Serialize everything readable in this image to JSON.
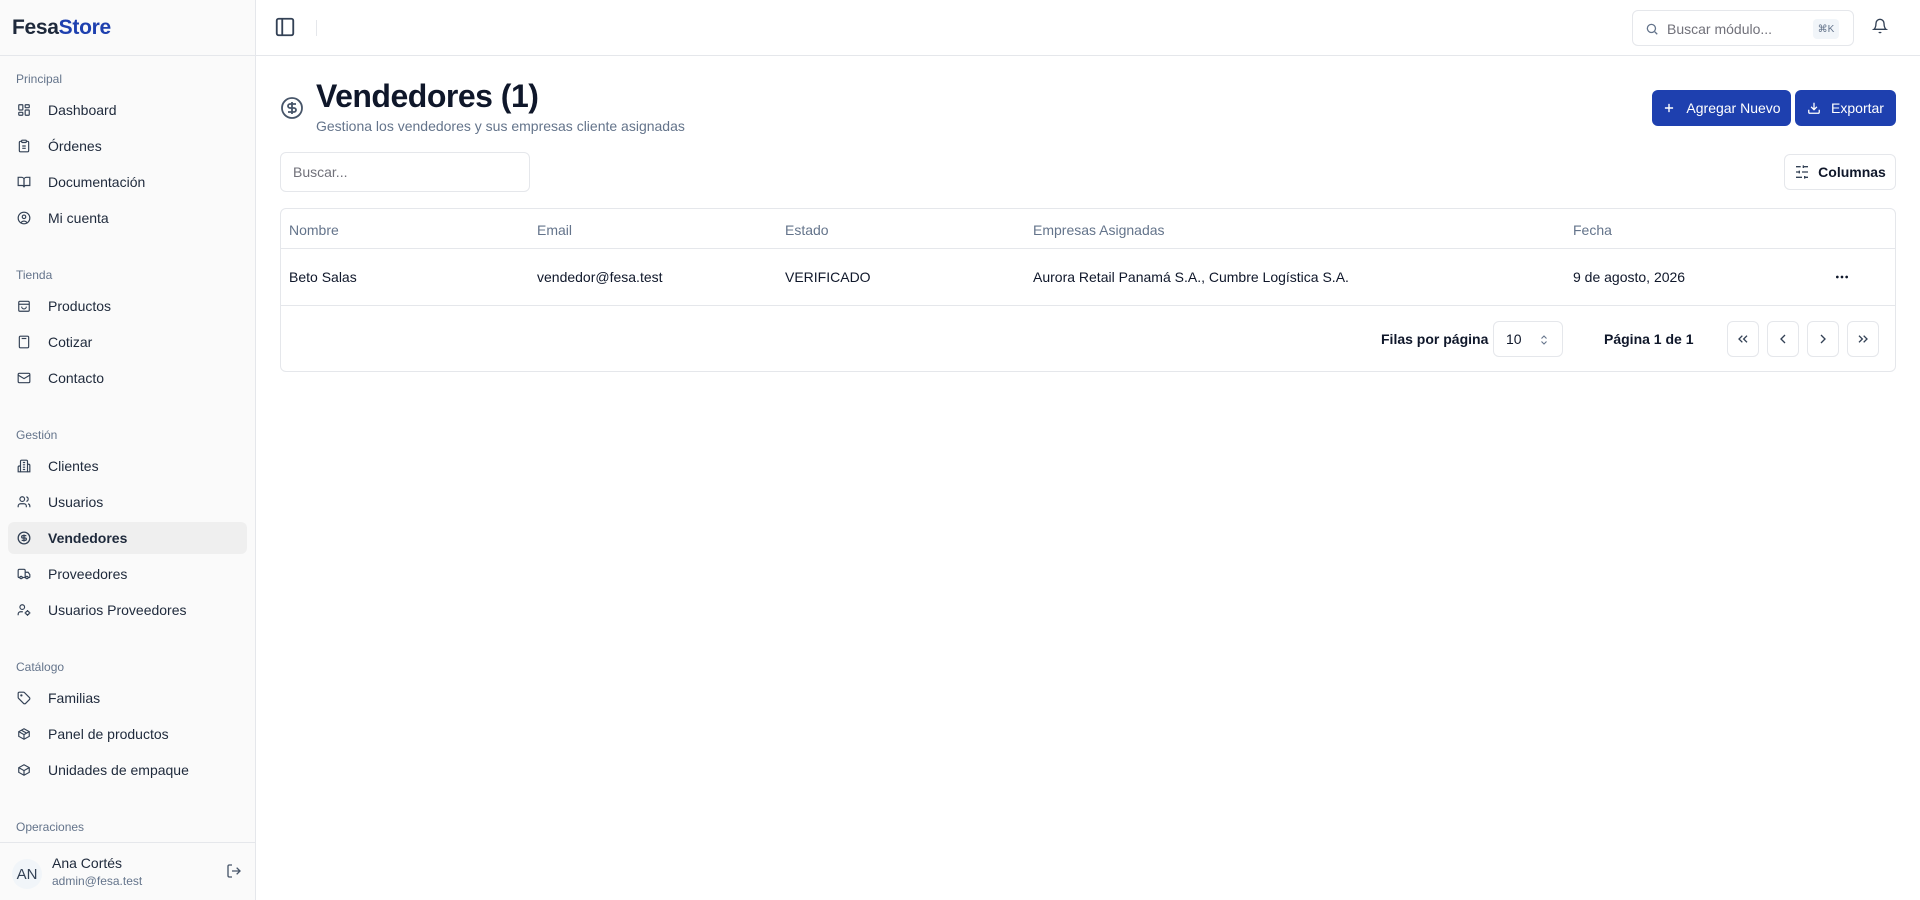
{
  "brand": {
    "part1": "Fesa",
    "part2": "Store"
  },
  "sidebar": {
    "groups": [
      {
        "label": "Principal",
        "items": [
          {
            "label": "Dashboard",
            "icon": "dashboard-icon"
          },
          {
            "label": "Órdenes",
            "icon": "clipboard-icon"
          },
          {
            "label": "Documentación",
            "icon": "book-open-icon"
          },
          {
            "label": "Mi cuenta",
            "icon": "user-circle-icon"
          }
        ]
      },
      {
        "label": "Tienda",
        "items": [
          {
            "label": "Productos",
            "icon": "shopping-bag-icon"
          },
          {
            "label": "Cotizar",
            "icon": "calculator-icon"
          },
          {
            "label": "Contacto",
            "icon": "mail-icon"
          }
        ]
      },
      {
        "label": "Gestión",
        "items": [
          {
            "label": "Clientes",
            "icon": "building-icon"
          },
          {
            "label": "Usuarios",
            "icon": "users-icon"
          },
          {
            "label": "Vendedores",
            "icon": "dollar-circle-icon",
            "active": true
          },
          {
            "label": "Proveedores",
            "icon": "truck-icon"
          },
          {
            "label": "Usuarios Proveedores",
            "icon": "user-cog-icon"
          }
        ]
      },
      {
        "label": "Catálogo",
        "items": [
          {
            "label": "Familias",
            "icon": "tag-icon"
          },
          {
            "label": "Panel de productos",
            "icon": "package-icon"
          },
          {
            "label": "Unidades de empaque",
            "icon": "box-icon"
          }
        ]
      },
      {
        "label": "Operaciones",
        "items": []
      }
    ],
    "user": {
      "initials": "AN",
      "name": "Ana Cortés",
      "email": "admin@fesa.test"
    }
  },
  "topbar": {
    "search_placeholder": "Buscar módulo...",
    "shortcut": "⌘K"
  },
  "main": {
    "title": "Vendedores (1)",
    "subtitle": "Gestiona los vendedores y sus empresas cliente asignadas",
    "add_label": "Agregar Nuevo",
    "export_label": "Exportar",
    "filter_placeholder": "Buscar...",
    "columns_label": "Columnas"
  },
  "table": {
    "headers": [
      "Nombre",
      "Email",
      "Estado",
      "Empresas Asignadas",
      "Fecha"
    ],
    "rows": [
      {
        "nombre": "Beto Salas",
        "email": "vendedor@fesa.test",
        "estado": "VERIFICADO",
        "empresas": "Aurora Retail Panamá S.A., Cumbre Logística S.A.",
        "fecha": "9 de agosto, 2026"
      }
    ]
  },
  "pagination": {
    "rows_label": "Filas por página",
    "rows_value": "10",
    "page_info": "Página 1 de 1"
  },
  "colors": {
    "accent": "#1e40af",
    "border": "#e5e7eb",
    "muted": "#64748b"
  }
}
